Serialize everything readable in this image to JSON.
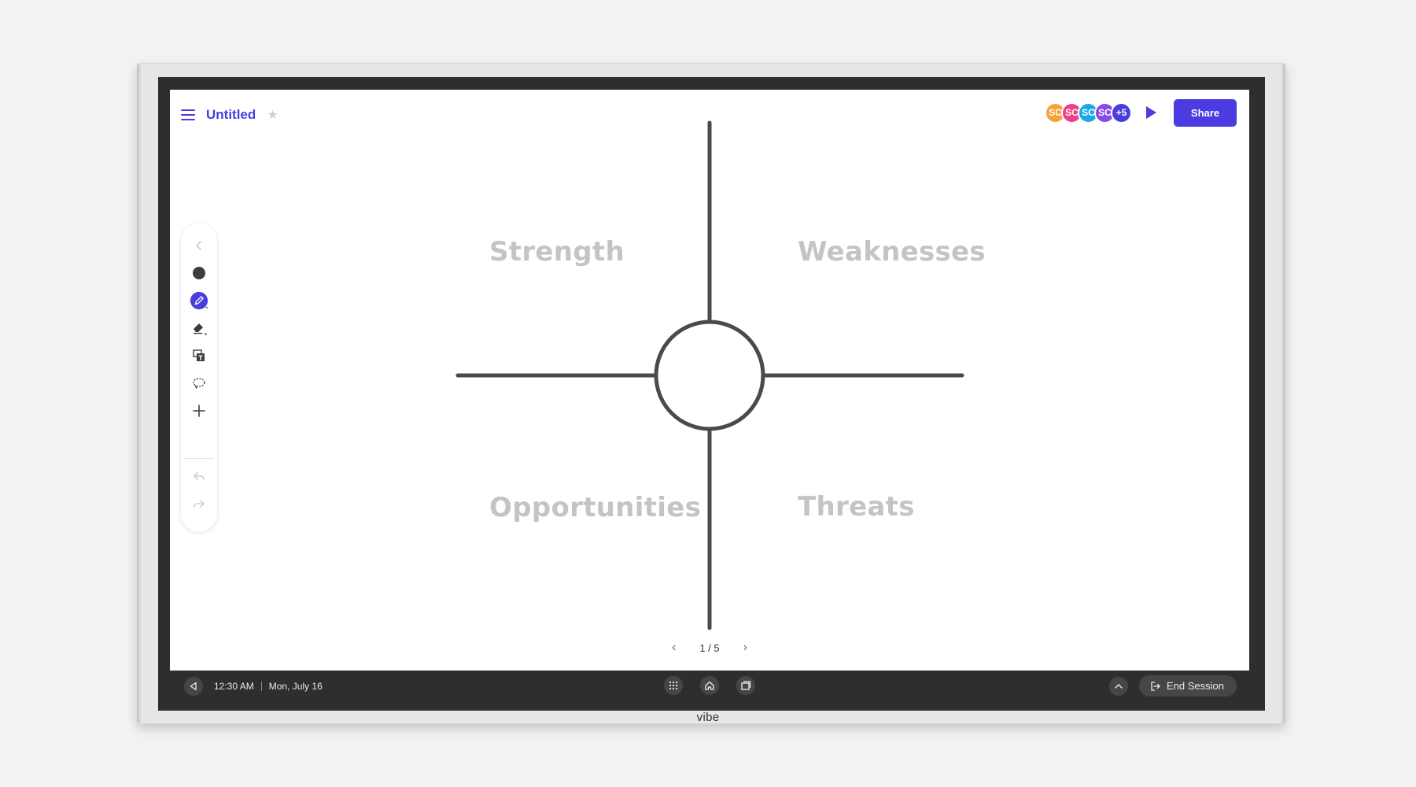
{
  "header": {
    "title": "Untitled",
    "avatars": [
      {
        "initials": "SC",
        "color": "#f5a23a"
      },
      {
        "initials": "SC",
        "color": "#ef3f86"
      },
      {
        "initials": "SC",
        "color": "#1aa8e8"
      },
      {
        "initials": "SC",
        "color": "#8a49e8"
      },
      {
        "initials": "+5",
        "color": "#4a3ce0"
      }
    ],
    "share_label": "Share"
  },
  "board": {
    "quadrants": {
      "top_left": "Strength",
      "top_right": "Weaknesses",
      "bottom_left": "Opportunities",
      "bottom_right": "Threats"
    }
  },
  "toolbar": {
    "tools": [
      "collapse-icon",
      "color-dot-icon",
      "pen-icon",
      "eraser-icon",
      "text-box-icon",
      "lasso-icon",
      "add-icon",
      "undo-icon",
      "redo-icon"
    ],
    "active_tool": "pen-icon"
  },
  "pager": {
    "label": "1 / 5"
  },
  "system_bar": {
    "time": "12:30 AM",
    "date": "Mon, July 16",
    "end_label": "End Session"
  },
  "device": {
    "brand": "vibe"
  },
  "colors": {
    "accent": "#4a3ce0",
    "label_gray": "#c4c4c6",
    "line": "#4a4a4c",
    "bezel": "#2e2e30"
  }
}
